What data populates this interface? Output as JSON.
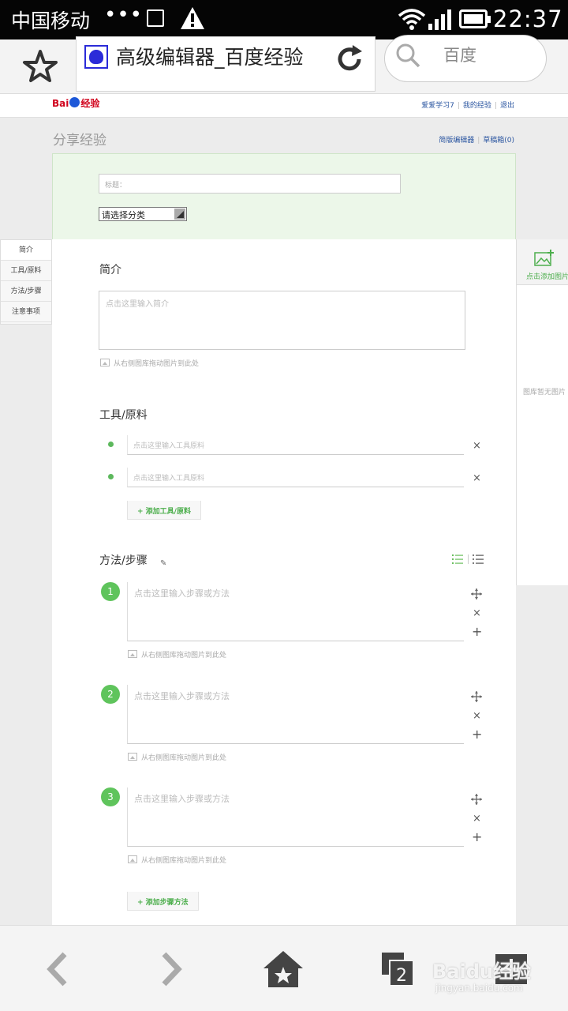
{
  "statusbar": {
    "carrier": "中国移动",
    "dots": "•••",
    "time": "22:37"
  },
  "browser": {
    "tab_title": "高级编辑器_百度经验",
    "search_placeholder": "百度"
  },
  "header": {
    "logo_left": "Bai",
    "logo_paw": "du",
    "logo_right": "经验",
    "user_link": "爱爱学习7",
    "my_link": "我的经验",
    "logout_link": "退出"
  },
  "page": {
    "title": "分享经验",
    "simple_editor_link": "简版编辑器",
    "drafts_link": "草稿箱(0)"
  },
  "form": {
    "title_placeholder": "标题：",
    "category_select": "请选择分类"
  },
  "leftnav": {
    "items": [
      {
        "label": "简介"
      },
      {
        "label": "工具/原料"
      },
      {
        "label": "方法/步骤"
      },
      {
        "label": "注意事项"
      }
    ]
  },
  "intro": {
    "heading": "简介",
    "placeholder": "点击这里输入简介",
    "drag_hint": "从右侧图库拖动图片到此处"
  },
  "tools": {
    "heading": "工具/原料",
    "items": [
      {
        "placeholder": "点击这里输入工具原料",
        "remove": "×"
      },
      {
        "placeholder": "点击这里输入工具原料",
        "remove": "×"
      }
    ],
    "add_label": "+ 添加工具/原料"
  },
  "steps": {
    "heading": "方法/步骤",
    "items": [
      {
        "number": "1",
        "placeholder": "点击这里输入步骤或方法",
        "drag_hint": "从右侧图库拖动图片到此处",
        "remove": "×",
        "add": "+"
      },
      {
        "number": "2",
        "placeholder": "点击这里输入步骤或方法",
        "drag_hint": "从右侧图库拖动图片到此处",
        "remove": "×",
        "add": "+"
      },
      {
        "number": "3",
        "placeholder": "点击这里输入步骤或方法",
        "drag_hint": "从右侧图库拖动图片到此处",
        "remove": "×",
        "add": "+"
      }
    ],
    "add_label": "+ 添加步骤方法"
  },
  "rightpanel": {
    "add_image": "点击添加图片",
    "gallery_empty": "图库暂无图片"
  },
  "watermark": {
    "brand": "Baidu经验",
    "url": "jingyan.baidu.com"
  },
  "colors": {
    "accent_green": "#5cb85c",
    "link_blue": "#2a55a0",
    "logo_red": "#d0021b",
    "panel_green": "#ecf7e9"
  }
}
